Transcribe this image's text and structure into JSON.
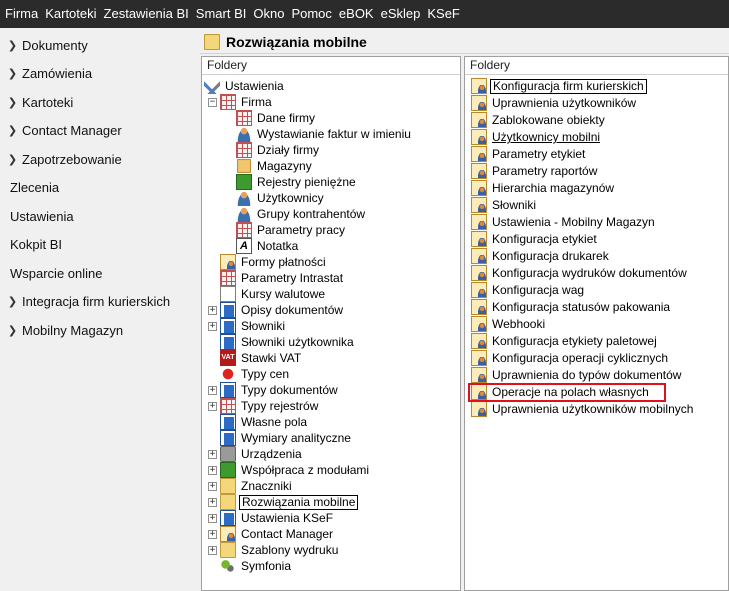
{
  "menu": [
    "Firma",
    "Kartoteki",
    "Zestawienia BI",
    "Smart BI",
    "Okno",
    "Pomoc",
    "eBOK",
    "eSklep",
    "KSeF"
  ],
  "sidebar": {
    "items": [
      {
        "label": "Dokumenty",
        "chevron": true
      },
      {
        "label": "Zamówienia",
        "chevron": true
      },
      {
        "label": "Kartoteki",
        "chevron": true
      },
      {
        "label": "Contact Manager",
        "chevron": true
      },
      {
        "label": "Zapotrzebowanie",
        "chevron": true
      },
      {
        "label": "Zlecenia",
        "chevron": false
      },
      {
        "label": "Ustawienia",
        "chevron": false
      },
      {
        "label": "Kokpit BI",
        "chevron": false
      },
      {
        "label": "Wsparcie online",
        "chevron": false
      },
      {
        "label": "Integracja firm kurierskich",
        "chevron": true
      },
      {
        "label": "Mobilny Magazyn",
        "chevron": true
      }
    ]
  },
  "main": {
    "title": "Rozwiązania mobilne",
    "left_panel_header": "Foldery",
    "right_panel_header": "Foldery"
  },
  "tree": {
    "root": "Ustawienia",
    "firma": "Firma",
    "firma_children": [
      "Dane firmy",
      "Wystawianie faktur w imieniu",
      "Działy firmy",
      "Magazyny",
      "Rejestry pieniężne",
      "Użytkownicy",
      "Grupy kontrahentów",
      "Parametry pracy",
      "Notatka"
    ],
    "items": [
      "Formy płatności",
      "Parametry Intrastat",
      "Kursy walutowe",
      "Opisy dokumentów",
      "Słowniki",
      "Słowniki użytkownika",
      "Stawki VAT",
      "Typy cen",
      "Typy dokumentów",
      "Typy rejestrów",
      "Własne pola",
      "Wymiary analityczne",
      "Urządzenia",
      "Współpraca z modułami",
      "Znaczniki",
      "Rozwiązania mobilne",
      "Ustawienia KSeF",
      "Contact Manager",
      "Szablony wydruku",
      "Symfonia"
    ]
  },
  "right_list": [
    "Konfiguracja firm kurierskich",
    "Uprawnienia użytkowników",
    "Zablokowane obiekty",
    "Użytkownicy mobilni",
    "Parametry etykiet",
    "Parametry raportów",
    "Hierarchia magazynów",
    "Słowniki",
    "Ustawienia - Mobilny Magazyn",
    "Konfiguracja etykiet",
    "Konfiguracja drukarek",
    "Konfiguracja wydruków dokumentów",
    "Konfiguracja wag",
    "Konfiguracja statusów pakowania",
    "Webhooki",
    "Konfiguracja etykiety paletowej",
    "Konfiguracja operacji cyklicznych",
    "Uprawnienia do typów dokumentów",
    "Operacje na polach własnych",
    "Uprawnienia użytkowników mobilnych"
  ],
  "colors": {
    "menubar_bg": "#2b2b2b",
    "highlight_red": "#e0101d"
  }
}
